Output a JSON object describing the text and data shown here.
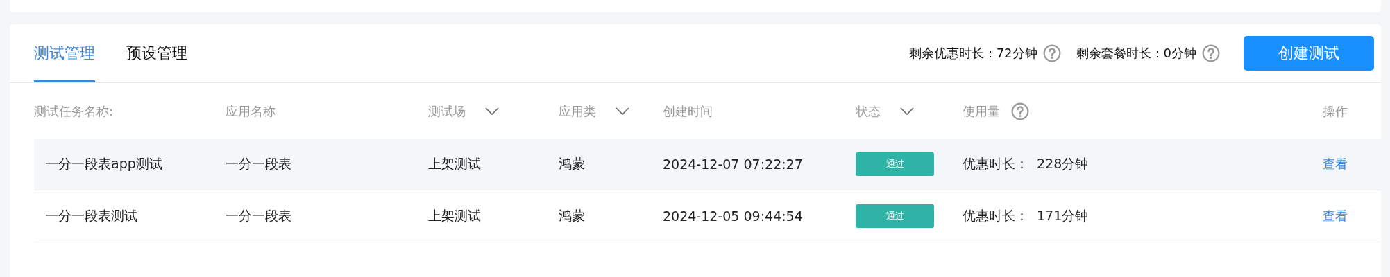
{
  "tabs": [
    {
      "label": "测试管理",
      "selected": true
    },
    {
      "label": "预设管理",
      "selected": false
    }
  ],
  "quota": [
    {
      "label": "剩余优惠时长：72分钟"
    },
    {
      "label": "剩余套餐时长：0分钟"
    }
  ],
  "create_button": "创建测试",
  "table": {
    "columns": [
      {
        "label": "测试任务名称:",
        "kind": "plain"
      },
      {
        "label": "应用名称",
        "kind": "plain"
      },
      {
        "label": "测试场",
        "kind": "filter"
      },
      {
        "label": "应用类",
        "kind": "filter"
      },
      {
        "label": "创建时间",
        "kind": "plain"
      },
      {
        "label": "状态",
        "kind": "filter"
      },
      {
        "label": "使用量",
        "kind": "help"
      },
      {
        "label": "操作",
        "kind": "plain"
      }
    ],
    "rows": [
      {
        "highlighted": true,
        "name": "一分一段表app测试",
        "app": "一分一段表",
        "scene": "上架测试",
        "type": "鸿蒙",
        "created": "2024-12-07 07:22:27",
        "status": "通过",
        "usage_label": "优惠时长：",
        "usage_value": "228分钟",
        "action": "查看"
      },
      {
        "highlighted": false,
        "name": "一分一段表测试",
        "app": "一分一段表",
        "scene": "上架测试",
        "type": "鸿蒙",
        "created": "2024-12-05 09:44:54",
        "status": "通过",
        "usage_label": "优惠时长：",
        "usage_value": "171分钟",
        "action": "查看"
      }
    ]
  }
}
